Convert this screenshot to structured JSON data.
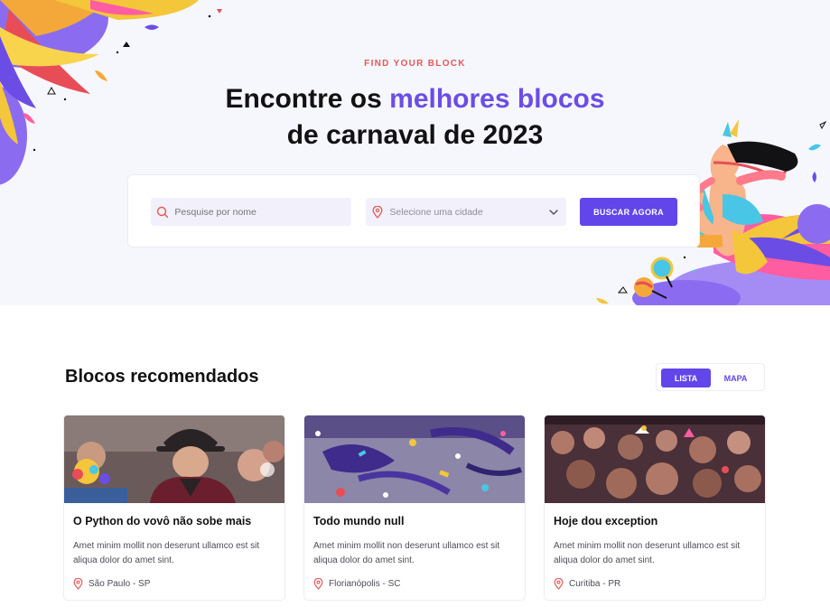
{
  "hero": {
    "eyebrow": "FIND YOUR BLOCK",
    "title_part1": "Encontre os ",
    "title_accent": "melhores blocos",
    "title_part2": "de carnaval de 2023"
  },
  "search": {
    "name_placeholder": "Pesquise por nome",
    "city_placeholder": "Selecione uma cidade",
    "button_label": "BUSCAR AGORA"
  },
  "recommended": {
    "title": "Blocos recomendados",
    "view_toggle": {
      "list_label": "LISTA",
      "map_label": "MAPA",
      "active": "LISTA"
    }
  },
  "cards": [
    {
      "title": "O Python do vovô não sobe mais",
      "description": "Amet minim mollit non deserunt ullamco est sit aliqua dolor do amet sint.",
      "location": "São Paulo - SP"
    },
    {
      "title": "Todo mundo null",
      "description": "Amet minim mollit non deserunt ullamco est sit aliqua dolor do amet sint.",
      "location": "Florianópolis - SC"
    },
    {
      "title": "Hoje dou exception",
      "description": "Amet minim mollit non deserunt ullamco est sit aliqua dolor do amet sint.",
      "location": "Curitiba - PR"
    }
  ],
  "icons": {
    "search": "search-icon",
    "location": "map-pin-icon",
    "dropdown": "chevron-down-icon"
  },
  "colors": {
    "primary": "#6246ea",
    "accent_red": "#e45858",
    "hero_bg": "#f6f6fd",
    "heading": "#121214"
  }
}
